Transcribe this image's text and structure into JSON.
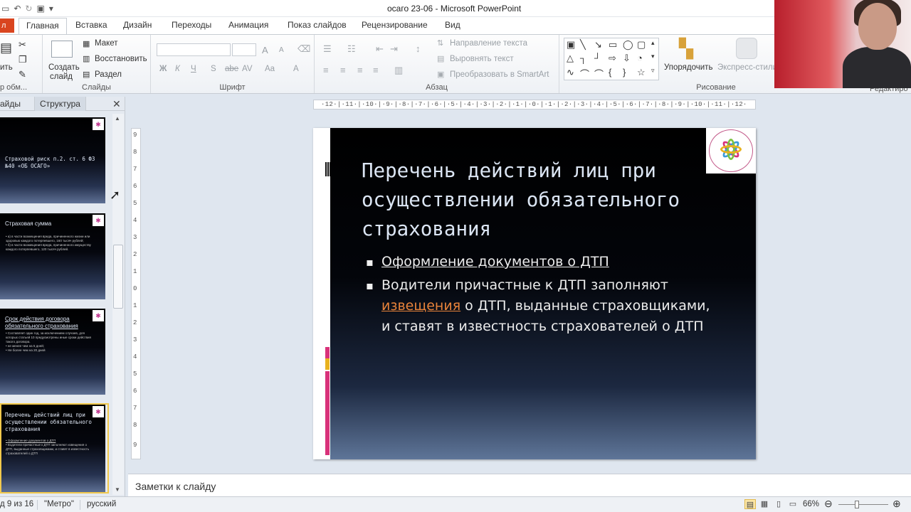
{
  "window": {
    "title": "осаго 23-06  -  Microsoft PowerPoint"
  },
  "quick_access": {
    "icons": [
      "save-icon",
      "undo-icon",
      "redo-icon",
      "new-icon",
      "customize-icon"
    ]
  },
  "tabs": {
    "file": "л",
    "items": [
      "Главная",
      "Вставка",
      "Дизайн",
      "Переходы",
      "Анимация",
      "Показ слайдов",
      "Рецензирование",
      "Вид"
    ]
  },
  "ribbon": {
    "clipboard": {
      "paste_label": "ить",
      "group_label": "р обм..."
    },
    "slides": {
      "new_slide": [
        "Создать",
        "слайд"
      ],
      "layout": "Макет",
      "reset": "Восстановить",
      "section": "Раздел",
      "group_label": "Слайды"
    },
    "font": {
      "group_label": "Шрифт",
      "bold": "Ж",
      "italic": "К",
      "underline": "Ч",
      "strike": "S",
      "spacing": "abe",
      "case": "AV",
      "aa": "Aa",
      "grow": "A",
      "shrink": "A"
    },
    "paragraph": {
      "text_direction": "Направление текста",
      "align_text": "Выровнять текст",
      "convert_smartart": "Преобразовать в SmartArt",
      "group_label": "Абзац"
    },
    "drawing": {
      "arrange": "Упорядочить",
      "quick_styles": "Экспресс-стили",
      "group_label": "Рисование",
      "editing": "Редактиро"
    }
  },
  "left_panel": {
    "tab_slides": "айды",
    "tab_outline": "Структура",
    "thumbnails": [
      {
        "title": "Страховой риск п.2. ст. 6 ФЗ №40 «ОБ ОСАГО»",
        "bullets": []
      },
      {
        "title": "Страховая сумма",
        "bullets": [
          "а) в части возмещения вреда, причиненного жизни или здоровью каждого потерпевшего, 160 тысяч рублей;",
          "б) в части возмещения вреда, причиненного имуществу каждого потерпевшего, 120 тысяч рублей."
        ]
      },
      {
        "title": "Срок действия договора обязательного страхования",
        "bullets": [
          "Составляет один год, за исключением случаев, для которых статьей 10 предусмотрены иные сроки действия такого договора.",
          "не менее чем на 5 дней;",
          "Не более чем на 20 дней"
        ]
      },
      {
        "title": "Перечень действий лиц при осуществлении обязательного страхования",
        "bullets": [
          "Оформление документов о ДТП",
          "Водители причастные к ДТП заполняют извещения о ДТП, выданные страховщиками, и ставят в известность страхователей о ДТП"
        ]
      }
    ]
  },
  "rulers": {
    "horizontal": "·12·|·11·|·10·|·9·|·8·|·7·|·6·|·5·|·4·|·3·|·2·|·1·|·0·|·1·|·2·|·3·|·4·|·5·|·6·|·7·|·8·|·9·|·10·|·11·|·12·",
    "vertical": [
      "9",
      "8",
      "7",
      "6",
      "5",
      "4",
      "3",
      "2",
      "1",
      "0",
      "1",
      "2",
      "3",
      "4",
      "5",
      "6",
      "7",
      "8",
      "9"
    ]
  },
  "slide": {
    "title": "Перечень действий лиц при осуществлении обязательного страхования",
    "bullet1": "Оформление документов о ДТП",
    "bullet2_before": "Водители причастные к  ДТП заполняют ",
    "bullet2_link": "извещения",
    "bullet2_after": " о ДТП, выданные страховщиками, и ставят в известность страхователей о ДТП"
  },
  "notes": {
    "placeholder": "Заметки к слайду"
  },
  "status": {
    "slide_info": "д 9 из 16",
    "theme": "\"Метро\"",
    "language": "русский",
    "zoom": "66%"
  },
  "colors": {
    "accent_file": "#d9451f",
    "slide_title": "#dbe5f3",
    "link": "#e8833a",
    "selection": "#f2c94c"
  }
}
